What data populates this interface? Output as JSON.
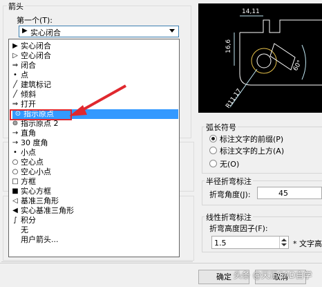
{
  "arrows": {
    "section_title": "箭头",
    "first_label": "第一个(T):",
    "first_value": "实心闭合",
    "items": [
      {
        "icon": "▶",
        "label": "实心闭合"
      },
      {
        "icon": "▷",
        "label": "空心闭合"
      },
      {
        "icon": "⇒",
        "label": "闭合"
      },
      {
        "icon": "•",
        "label": "点"
      },
      {
        "icon": "╱",
        "label": "建筑标记"
      },
      {
        "icon": "╱",
        "label": "倾斜"
      },
      {
        "icon": "⇒",
        "label": "打开"
      },
      {
        "icon": "⊙",
        "label": "指示原点"
      },
      {
        "icon": "⊚",
        "label": "指示原点 2"
      },
      {
        "icon": "→",
        "label": "直角"
      },
      {
        "icon": "→",
        "label": "30 度角"
      },
      {
        "icon": "•",
        "label": "小点"
      },
      {
        "icon": "○",
        "label": "空心点"
      },
      {
        "icon": "○",
        "label": "空心小点"
      },
      {
        "icon": "□",
        "label": "方框"
      },
      {
        "icon": "■",
        "label": "实心方框"
      },
      {
        "icon": "◁",
        "label": "基准三角形"
      },
      {
        "icon": "◀",
        "label": "实心基准三角形"
      },
      {
        "icon": "∫",
        "label": "积分"
      },
      {
        "icon": "",
        "label": "无"
      },
      {
        "icon": "",
        "label": "用户箭头..."
      }
    ],
    "selected_item": "指示原点"
  },
  "preview": {
    "dim_top": "14,11",
    "dim_left": "16,6",
    "dim_radius": "R11,17",
    "dim_angle": "60°"
  },
  "arc": {
    "title": "弧长符号",
    "opt1": "标注文字的前缀(P)",
    "opt2": "标注文字的上方(A)",
    "opt3": "无(O)"
  },
  "radius_jog": {
    "title": "半径折弯标注",
    "angle_label": "折弯角度(J):",
    "angle_value": "45"
  },
  "linear_jog": {
    "title": "线性折弯标注",
    "factor_label": "折弯高度因子(F):",
    "factor_value": "1.5",
    "factor_suffix": "* 文字高"
  },
  "buttons": {
    "ok": "确定",
    "cancel": "取消"
  },
  "watermark": "头条 @天正CAD自学",
  "colors": {
    "selection": "#3399ff",
    "callout": "#e0282e",
    "dim_yellow": "#e6c14a",
    "dim_cyan": "#bfe6f2"
  }
}
